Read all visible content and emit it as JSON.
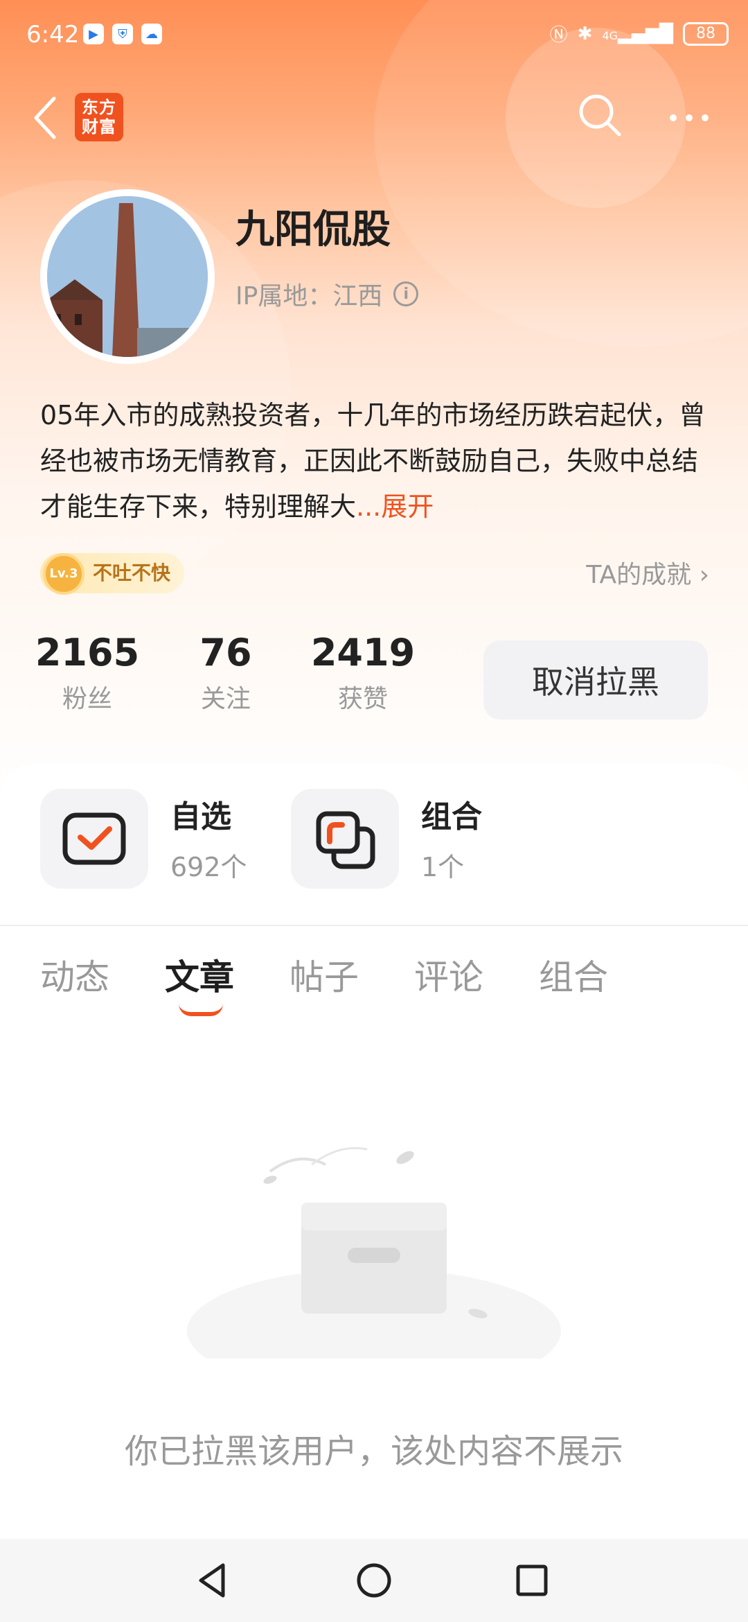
{
  "status_bar": {
    "time": "6:42",
    "signal": "4G",
    "battery": "88",
    "icons": [
      "video-app-icon",
      "shield-app-icon",
      "weather-app-icon",
      "nfc-icon",
      "bluetooth-icon",
      "signal-icon",
      "battery-icon"
    ]
  },
  "header": {
    "app_logo_line1": "东方",
    "app_logo_line2": "财富",
    "brand_color": "#f0521f"
  },
  "profile": {
    "name": "九阳侃股",
    "ip_location": "IP属地：江西",
    "bio": "05年入市的成熟投资者，十几年的市场经历跌宕起伏，曾经也被市场无情教育，正因此不断鼓励自己，失败中总结才能生存下来，特别理解大",
    "bio_expand": "...展开",
    "level_badge": "Lv.3",
    "level_title": "不吐不快",
    "achievement_link": "TA的成就"
  },
  "stats": [
    {
      "value": "2165",
      "label": "粉丝"
    },
    {
      "value": "76",
      "label": "关注"
    },
    {
      "value": "2419",
      "label": "获赞"
    }
  ],
  "unblock_button": "取消拉黑",
  "entries": [
    {
      "title": "自选",
      "sub": "692个"
    },
    {
      "title": "组合",
      "sub": "1个"
    }
  ],
  "tabs": [
    {
      "label": "动态"
    },
    {
      "label": "文章"
    },
    {
      "label": "帖子"
    },
    {
      "label": "评论"
    },
    {
      "label": "组合"
    }
  ],
  "active_tab": "文章",
  "empty_message": "你已拉黑该用户，该处内容不展示"
}
